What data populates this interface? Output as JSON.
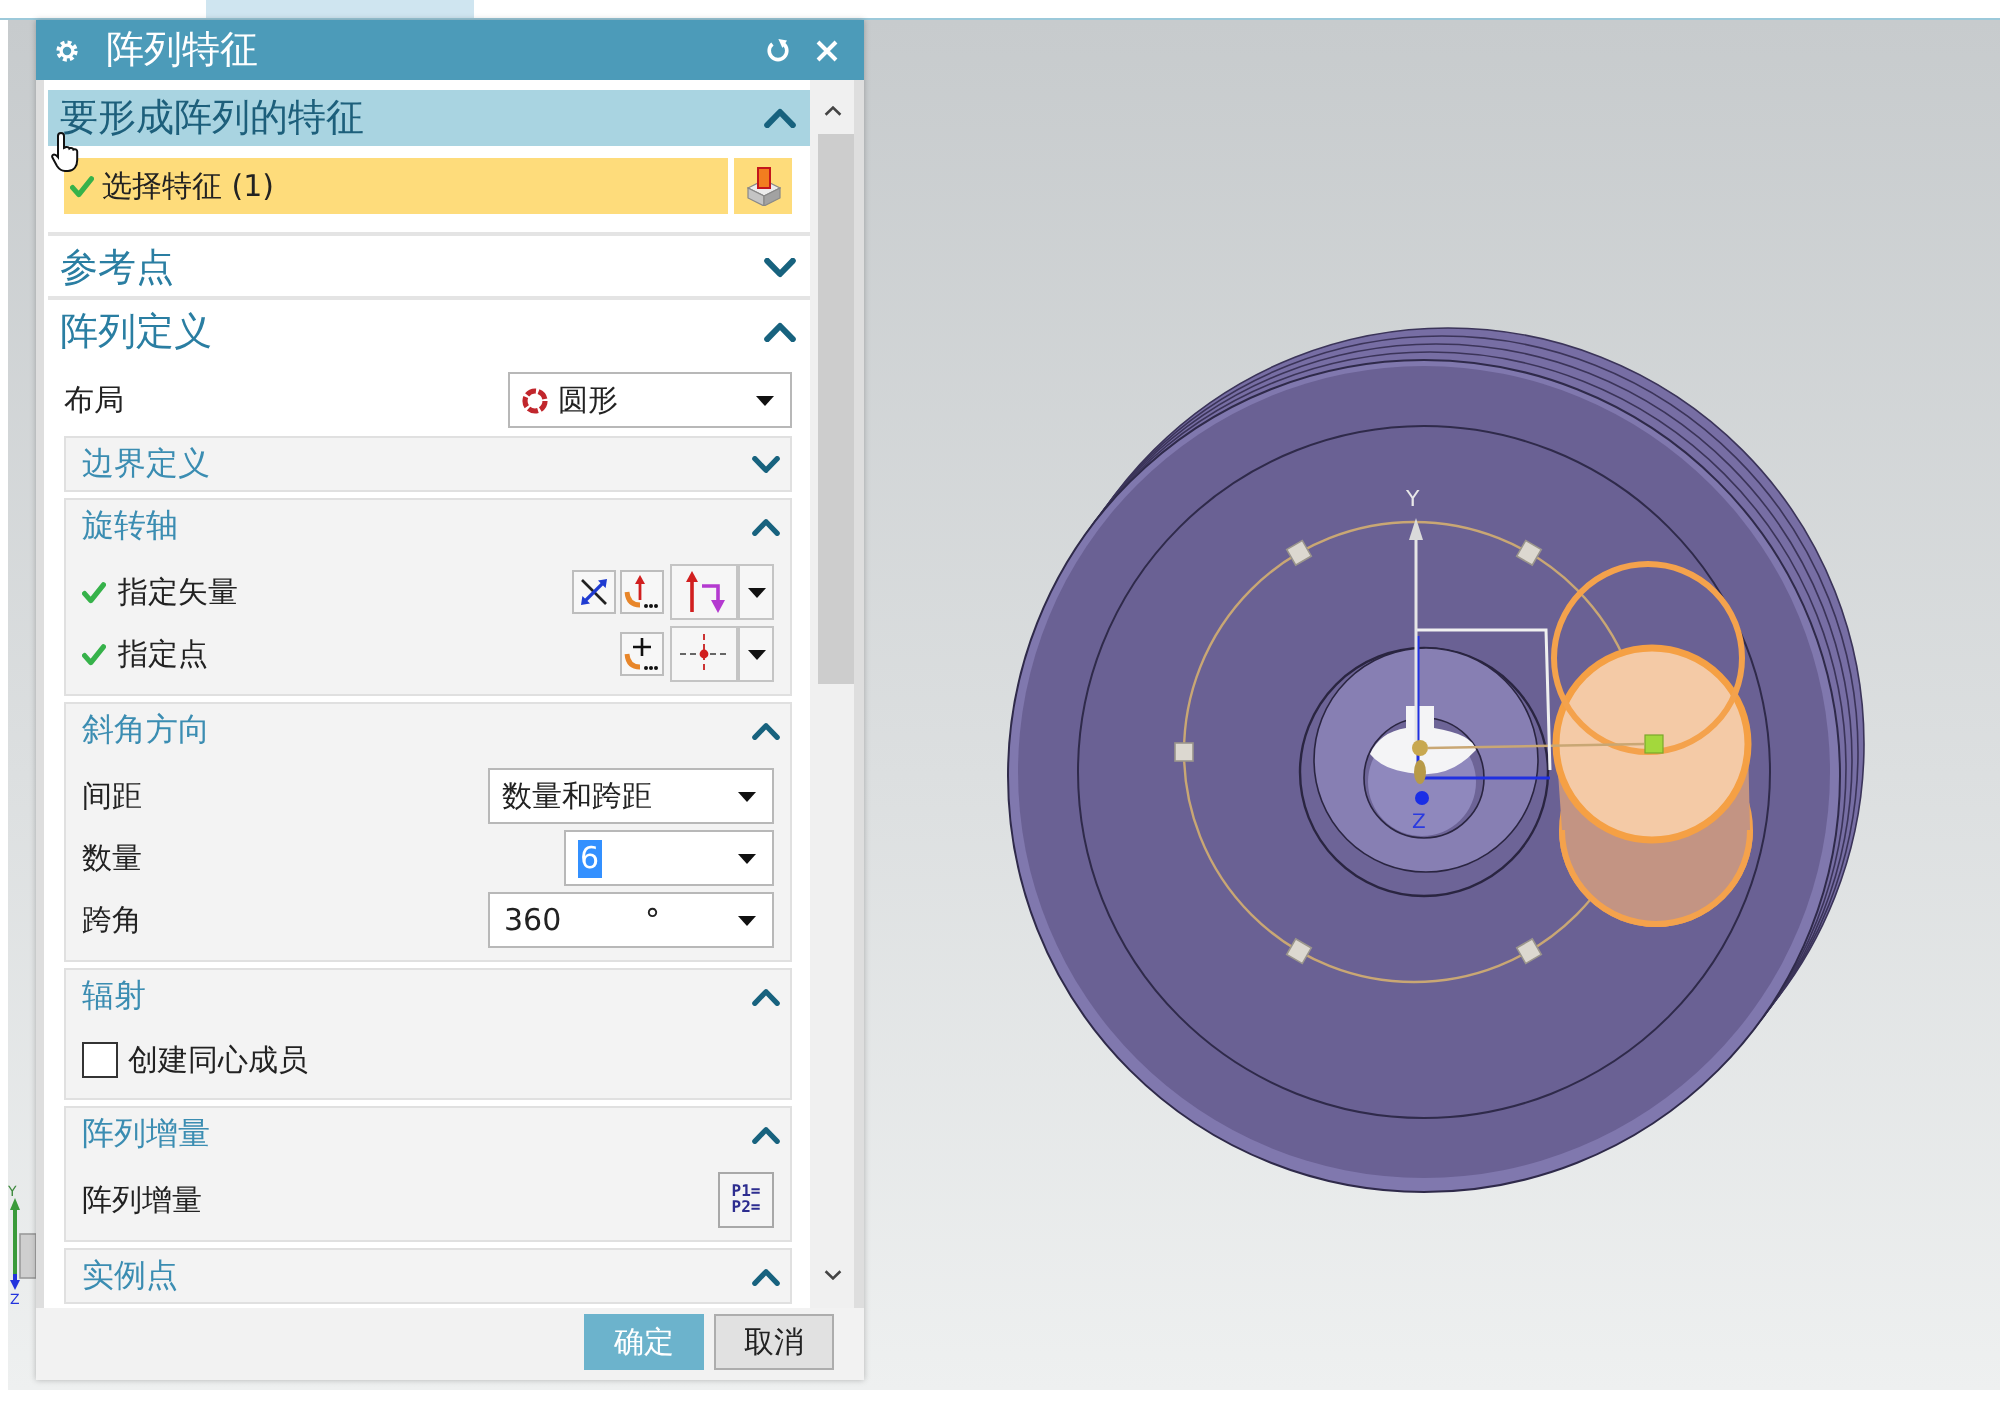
{
  "dialog": {
    "title": "阵列特征",
    "sections": [
      {
        "title": "要形成阵列的特征",
        "selected": true,
        "expanded": true,
        "rows": [
          {
            "kind": "selection",
            "label": "选择特征 (1)",
            "checked": true,
            "selected": true
          }
        ]
      },
      {
        "title": "参考点",
        "selected": false,
        "expanded": false
      },
      {
        "title": "阵列定义",
        "selected": false,
        "expanded": true,
        "rows": [
          {
            "kind": "layout",
            "label": "布局",
            "value": "圆形"
          }
        ],
        "groups": [
          {
            "title": "边界定义",
            "expanded": false
          },
          {
            "title": "旋转轴",
            "expanded": true,
            "rows": [
              {
                "kind": "vector",
                "label": "指定矢量",
                "checked": true
              },
              {
                "kind": "point",
                "label": "指定点",
                "checked": true
              }
            ]
          },
          {
            "title": "斜角方向",
            "expanded": true,
            "rows": [
              {
                "kind": "dropdown",
                "label": "间距",
                "value": "数量和跨距"
              },
              {
                "kind": "number",
                "label": "数量",
                "value": "6",
                "selected": true
              },
              {
                "kind": "number",
                "label": "跨角",
                "value": "360",
                "unit": "°",
                "selected": false
              }
            ]
          },
          {
            "title": "辐射",
            "expanded": true,
            "rows": [
              {
                "kind": "checkbox",
                "label": "创建同心成员",
                "checked": false
              }
            ]
          },
          {
            "title": "阵列增量",
            "expanded": true,
            "rows": [
              {
                "kind": "increment",
                "label": "阵列增量",
                "button_lines": [
                  "P1=",
                  "P2="
                ]
              }
            ]
          },
          {
            "title": "实例点",
            "expanded": true
          }
        ]
      }
    ],
    "buttons": [
      {
        "label": "确定",
        "kind": "primary"
      },
      {
        "label": "取消",
        "kind": "secondary"
      }
    ]
  },
  "viewport": {
    "model_axis_labels": [
      "Y",
      "Z"
    ],
    "triad_labels": [
      "Y",
      "Z"
    ]
  }
}
